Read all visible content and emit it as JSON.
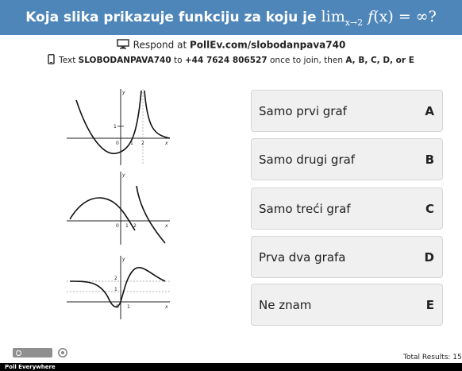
{
  "header": {
    "question": "Koja slika prikazuje funkciju za koju je",
    "lim": "lim",
    "lim_sub": "x→2",
    "expr_f": "f",
    "expr_rest": "(x) = ∞?"
  },
  "respond": {
    "prefix": "Respond at",
    "url": "PollEv.com/slobodanpava740"
  },
  "text_line": {
    "prefix": "Text",
    "code": "SLOBODANPAVA740",
    "to": "to",
    "number": "+44 7624 806527",
    "mid": "once to join, then",
    "choices": "A, B, C, D, or E"
  },
  "options": [
    {
      "label": "Samo prvi graf",
      "key": "A"
    },
    {
      "label": "Samo drugi graf",
      "key": "B"
    },
    {
      "label": "Samo treći graf",
      "key": "C"
    },
    {
      "label": "Prva dva grafa",
      "key": "D"
    },
    {
      "label": "Ne znam",
      "key": "E"
    }
  ],
  "graphs": {
    "g1": {
      "y": "y",
      "x": "x",
      "o": "0",
      "one": "1",
      "two": "2",
      "yone": "1"
    },
    "g2": {
      "y": "y",
      "x": "x",
      "o": "0",
      "one": "1",
      "two": "2"
    },
    "g3": {
      "y": "y",
      "x": "x",
      "o": "0",
      "one": "1",
      "ytwo": "2",
      "yone": "1"
    }
  },
  "footer": {
    "brand": "Poll Everywhere",
    "total": "Total Results: 15"
  }
}
